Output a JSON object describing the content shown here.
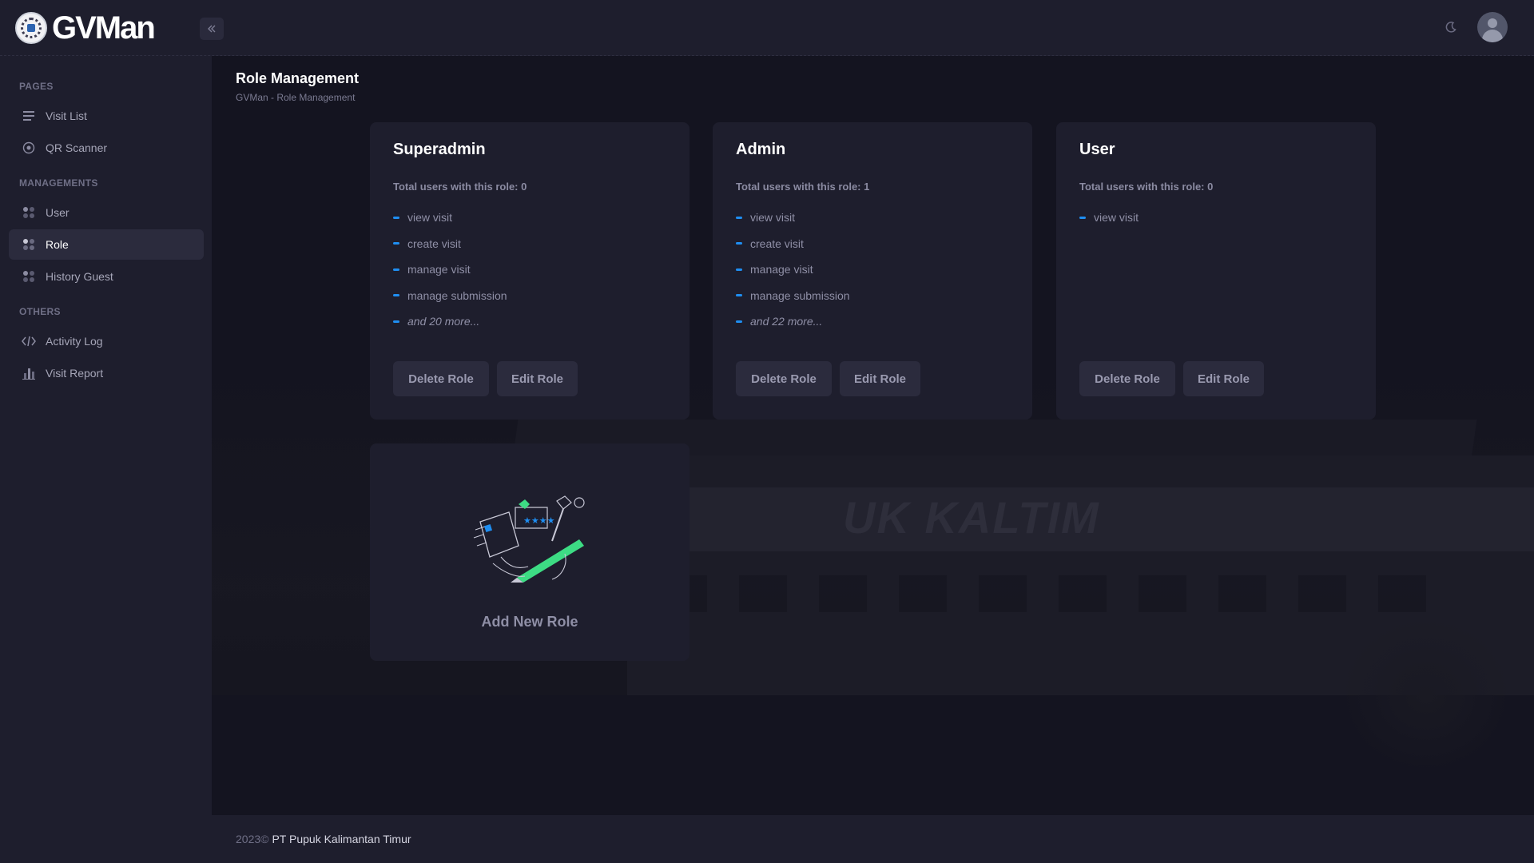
{
  "app": {
    "logo_text": "GVMan",
    "collapse_icon": "double-chevron-left-icon",
    "theme_icon": "moon-icon",
    "avatar_icon": "user-avatar-icon"
  },
  "colors": {
    "accent": "#1f8ef1",
    "background": "#1b1b29",
    "card": "#1e1e2d",
    "button": "#2b2b3d",
    "illustration_green": "#3ddc84"
  },
  "sidebar": {
    "sections": [
      {
        "title": "PAGES",
        "items": [
          {
            "label": "Visit List",
            "icon": "list-icon"
          },
          {
            "label": "QR Scanner",
            "icon": "scan-icon"
          }
        ]
      },
      {
        "title": "MANAGEMENTS",
        "items": [
          {
            "label": "User",
            "icon": "grid-dots-icon"
          },
          {
            "label": "Role",
            "icon": "grid-dots-icon",
            "active": true
          },
          {
            "label": "History Guest",
            "icon": "grid-dots-icon"
          }
        ]
      },
      {
        "title": "OTHERS",
        "items": [
          {
            "label": "Activity Log",
            "icon": "code-icon"
          },
          {
            "label": "Visit Report",
            "icon": "bar-chart-icon"
          }
        ]
      }
    ]
  },
  "main": {
    "title": "Role Management",
    "breadcrumb": "GVMan - Role Management",
    "background_sign": "UK   KALTIM",
    "roles": [
      {
        "name": "Superadmin",
        "users": "Total users with this role: 0",
        "permissions": [
          "view visit",
          "create visit",
          "manage visit",
          "manage submission"
        ],
        "more": "and 20 more...",
        "delete_label": "Delete Role",
        "edit_label": "Edit Role"
      },
      {
        "name": "Admin",
        "users": "Total users with this role: 1",
        "permissions": [
          "view visit",
          "create visit",
          "manage visit",
          "manage submission"
        ],
        "more": "and 22 more...",
        "delete_label": "Delete Role",
        "edit_label": "Edit Role"
      },
      {
        "name": "User",
        "users": "Total users with this role: 0",
        "permissions": [
          "view visit"
        ],
        "more": "",
        "delete_label": "Delete Role",
        "edit_label": "Edit Role"
      }
    ],
    "add_role_label": "Add New Role"
  },
  "footer": {
    "year": "2023©",
    "company": "PT Pupuk Kalimantan Timur"
  }
}
